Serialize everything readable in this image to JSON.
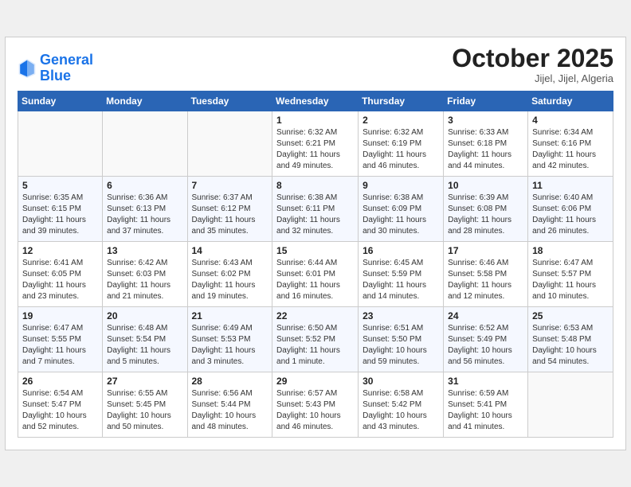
{
  "logo": {
    "line1": "General",
    "line2": "Blue"
  },
  "title": "October 2025",
  "location": "Jijel, Jijel, Algeria",
  "weekdays": [
    "Sunday",
    "Monday",
    "Tuesday",
    "Wednesday",
    "Thursday",
    "Friday",
    "Saturday"
  ],
  "weeks": [
    [
      {
        "day": "",
        "info": ""
      },
      {
        "day": "",
        "info": ""
      },
      {
        "day": "",
        "info": ""
      },
      {
        "day": "1",
        "info": "Sunrise: 6:32 AM\nSunset: 6:21 PM\nDaylight: 11 hours\nand 49 minutes."
      },
      {
        "day": "2",
        "info": "Sunrise: 6:32 AM\nSunset: 6:19 PM\nDaylight: 11 hours\nand 46 minutes."
      },
      {
        "day": "3",
        "info": "Sunrise: 6:33 AM\nSunset: 6:18 PM\nDaylight: 11 hours\nand 44 minutes."
      },
      {
        "day": "4",
        "info": "Sunrise: 6:34 AM\nSunset: 6:16 PM\nDaylight: 11 hours\nand 42 minutes."
      }
    ],
    [
      {
        "day": "5",
        "info": "Sunrise: 6:35 AM\nSunset: 6:15 PM\nDaylight: 11 hours\nand 39 minutes."
      },
      {
        "day": "6",
        "info": "Sunrise: 6:36 AM\nSunset: 6:13 PM\nDaylight: 11 hours\nand 37 minutes."
      },
      {
        "day": "7",
        "info": "Sunrise: 6:37 AM\nSunset: 6:12 PM\nDaylight: 11 hours\nand 35 minutes."
      },
      {
        "day": "8",
        "info": "Sunrise: 6:38 AM\nSunset: 6:11 PM\nDaylight: 11 hours\nand 32 minutes."
      },
      {
        "day": "9",
        "info": "Sunrise: 6:38 AM\nSunset: 6:09 PM\nDaylight: 11 hours\nand 30 minutes."
      },
      {
        "day": "10",
        "info": "Sunrise: 6:39 AM\nSunset: 6:08 PM\nDaylight: 11 hours\nand 28 minutes."
      },
      {
        "day": "11",
        "info": "Sunrise: 6:40 AM\nSunset: 6:06 PM\nDaylight: 11 hours\nand 26 minutes."
      }
    ],
    [
      {
        "day": "12",
        "info": "Sunrise: 6:41 AM\nSunset: 6:05 PM\nDaylight: 11 hours\nand 23 minutes."
      },
      {
        "day": "13",
        "info": "Sunrise: 6:42 AM\nSunset: 6:03 PM\nDaylight: 11 hours\nand 21 minutes."
      },
      {
        "day": "14",
        "info": "Sunrise: 6:43 AM\nSunset: 6:02 PM\nDaylight: 11 hours\nand 19 minutes."
      },
      {
        "day": "15",
        "info": "Sunrise: 6:44 AM\nSunset: 6:01 PM\nDaylight: 11 hours\nand 16 minutes."
      },
      {
        "day": "16",
        "info": "Sunrise: 6:45 AM\nSunset: 5:59 PM\nDaylight: 11 hours\nand 14 minutes."
      },
      {
        "day": "17",
        "info": "Sunrise: 6:46 AM\nSunset: 5:58 PM\nDaylight: 11 hours\nand 12 minutes."
      },
      {
        "day": "18",
        "info": "Sunrise: 6:47 AM\nSunset: 5:57 PM\nDaylight: 11 hours\nand 10 minutes."
      }
    ],
    [
      {
        "day": "19",
        "info": "Sunrise: 6:47 AM\nSunset: 5:55 PM\nDaylight: 11 hours\nand 7 minutes."
      },
      {
        "day": "20",
        "info": "Sunrise: 6:48 AM\nSunset: 5:54 PM\nDaylight: 11 hours\nand 5 minutes."
      },
      {
        "day": "21",
        "info": "Sunrise: 6:49 AM\nSunset: 5:53 PM\nDaylight: 11 hours\nand 3 minutes."
      },
      {
        "day": "22",
        "info": "Sunrise: 6:50 AM\nSunset: 5:52 PM\nDaylight: 11 hours\nand 1 minute."
      },
      {
        "day": "23",
        "info": "Sunrise: 6:51 AM\nSunset: 5:50 PM\nDaylight: 10 hours\nand 59 minutes."
      },
      {
        "day": "24",
        "info": "Sunrise: 6:52 AM\nSunset: 5:49 PM\nDaylight: 10 hours\nand 56 minutes."
      },
      {
        "day": "25",
        "info": "Sunrise: 6:53 AM\nSunset: 5:48 PM\nDaylight: 10 hours\nand 54 minutes."
      }
    ],
    [
      {
        "day": "26",
        "info": "Sunrise: 6:54 AM\nSunset: 5:47 PM\nDaylight: 10 hours\nand 52 minutes."
      },
      {
        "day": "27",
        "info": "Sunrise: 6:55 AM\nSunset: 5:45 PM\nDaylight: 10 hours\nand 50 minutes."
      },
      {
        "day": "28",
        "info": "Sunrise: 6:56 AM\nSunset: 5:44 PM\nDaylight: 10 hours\nand 48 minutes."
      },
      {
        "day": "29",
        "info": "Sunrise: 6:57 AM\nSunset: 5:43 PM\nDaylight: 10 hours\nand 46 minutes."
      },
      {
        "day": "30",
        "info": "Sunrise: 6:58 AM\nSunset: 5:42 PM\nDaylight: 10 hours\nand 43 minutes."
      },
      {
        "day": "31",
        "info": "Sunrise: 6:59 AM\nSunset: 5:41 PM\nDaylight: 10 hours\nand 41 minutes."
      },
      {
        "day": "",
        "info": ""
      }
    ]
  ]
}
